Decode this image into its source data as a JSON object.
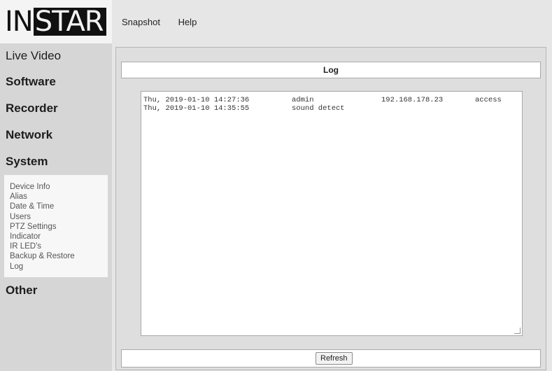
{
  "logo": {
    "part1": "IN",
    "part2": "STAR"
  },
  "topmenu": [
    {
      "label": "Snapshot"
    },
    {
      "label": "Help"
    }
  ],
  "sidebar": {
    "items": [
      {
        "label": "Live Video"
      },
      {
        "label": "Software"
      },
      {
        "label": "Recorder"
      },
      {
        "label": "Network"
      },
      {
        "label": "System"
      }
    ],
    "submenu": [
      {
        "label": "Device Info"
      },
      {
        "label": "Alias"
      },
      {
        "label": "Date & Time"
      },
      {
        "label": "Users"
      },
      {
        "label": "PTZ Settings"
      },
      {
        "label": "Indicator"
      },
      {
        "label": "IR LED's"
      },
      {
        "label": "Backup & Restore"
      },
      {
        "label": "Log"
      }
    ],
    "other": {
      "label": "Other"
    }
  },
  "panel": {
    "title": "Log",
    "log": [
      {
        "date": "Thu, 2019-01-10 14:27:36",
        "user": "admin",
        "ip": "192.168.178.23",
        "event": "access"
      },
      {
        "date": "Thu, 2019-01-10 14:35:55",
        "user": "sound detect",
        "ip": "",
        "event": ""
      }
    ],
    "refresh_label": "Refresh"
  }
}
